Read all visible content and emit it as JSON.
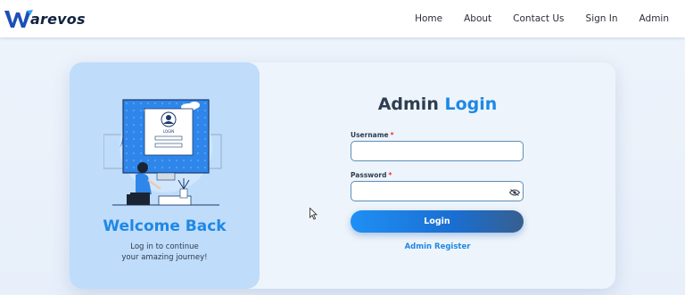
{
  "header": {
    "logo_text": "arevos",
    "nav": [
      {
        "label": "Home"
      },
      {
        "label": "About"
      },
      {
        "label": "Contact Us"
      },
      {
        "label": "Sign In"
      },
      {
        "label": "Admin"
      }
    ]
  },
  "left_panel": {
    "illustration_screen_text": "LOGIN",
    "title": "Welcome Back",
    "subtitle_line1": "Log in to continue",
    "subtitle_line2": "your amazing journey!"
  },
  "form": {
    "title_part1": "Admin",
    "title_part2": "Login",
    "username_label": "Username",
    "password_label": "Password",
    "required_mark": "*",
    "username_value": "",
    "password_value": "",
    "login_button": "Login",
    "register_link": "Admin Register"
  },
  "colors": {
    "accent": "#1e88e5",
    "panel": "#bfdcfb",
    "required": "#e53935"
  },
  "icons": {
    "eye": "eye-slash-icon",
    "cursor": "mouse-pointer-icon"
  }
}
